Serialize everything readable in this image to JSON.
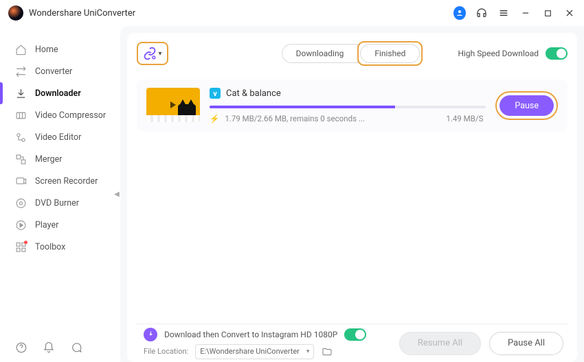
{
  "app": {
    "title": "Wondershare UniConverter"
  },
  "sidebar": {
    "items": [
      {
        "label": "Home",
        "icon": "home"
      },
      {
        "label": "Converter",
        "icon": "converter"
      },
      {
        "label": "Downloader",
        "icon": "downloader",
        "active": true
      },
      {
        "label": "Video Compressor",
        "icon": "compressor"
      },
      {
        "label": "Video Editor",
        "icon": "editor"
      },
      {
        "label": "Merger",
        "icon": "merger"
      },
      {
        "label": "Screen Recorder",
        "icon": "recorder"
      },
      {
        "label": "DVD Burner",
        "icon": "dvd"
      },
      {
        "label": "Player",
        "icon": "player"
      },
      {
        "label": "Toolbox",
        "icon": "toolbox"
      }
    ]
  },
  "tabs": {
    "downloading": "Downloading",
    "finished": "Finished"
  },
  "highspeed": {
    "label": "High Speed Download"
  },
  "download": {
    "title": "Cat & balance",
    "source": "vimeo",
    "progress_percent": 67,
    "status_text": "1.79 MB/2.66 MB, remains 0 seconds ...",
    "speed": "1.49 MB/S",
    "pause_label": "Pause"
  },
  "footer": {
    "convert_label": "Download then Convert to Instagram HD 1080P",
    "file_location_label": "File Location:",
    "file_location_value": "E:\\Wondershare UniConverter",
    "resume_all": "Resume All",
    "pause_all": "Pause All"
  }
}
